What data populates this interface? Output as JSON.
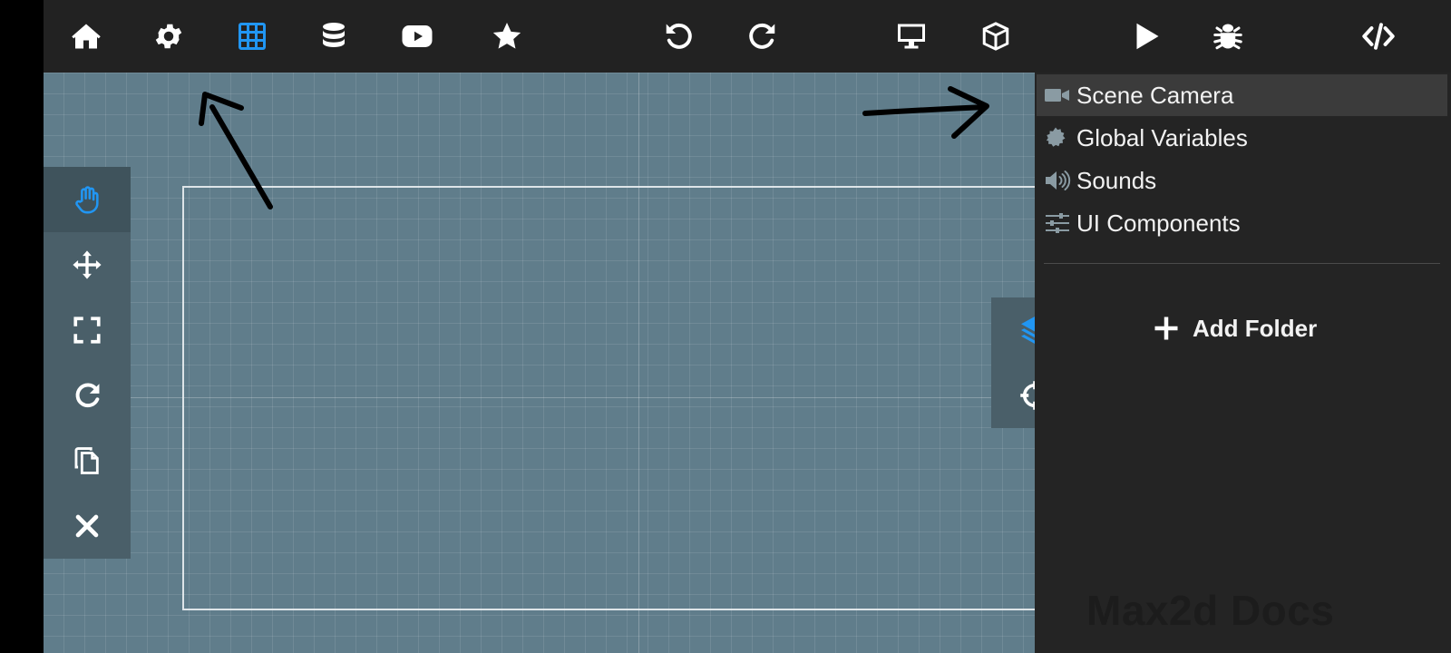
{
  "toolbar": {
    "icons": [
      "home-icon",
      "settings-icon",
      "grid-icon",
      "database-icon",
      "youtube-icon",
      "star-icon",
      "undo-icon",
      "redo-icon",
      "monitor-icon",
      "cube-icon",
      "play-icon",
      "bug-icon",
      "code-icon"
    ],
    "active_icon": "grid-icon"
  },
  "left_tools": {
    "icons": [
      "hand-icon",
      "move-icon",
      "scale-icon",
      "rotate-icon",
      "copy-icon",
      "delete-icon"
    ],
    "active_icon": "hand-icon"
  },
  "right_tools": {
    "icons": [
      "layers-icon",
      "crosshair-icon"
    ]
  },
  "side_panel": {
    "items": [
      {
        "label": "Scene Camera",
        "icon": "video-camera-icon",
        "selected": true
      },
      {
        "label": "Global Variables",
        "icon": "badge-icon",
        "selected": false
      },
      {
        "label": "Sounds",
        "icon": "speaker-icon",
        "selected": false
      },
      {
        "label": "UI Components",
        "icon": "sliders-icon",
        "selected": false
      }
    ],
    "add_folder_label": "Add Folder",
    "watermark": "Max2d Docs"
  },
  "colors": {
    "toolbar_bg": "#222222",
    "canvas_bg": "#607d8b",
    "panel_bg": "#242424",
    "tool_panel_bg": "#4a5f69",
    "accent": "#2196f3",
    "icon": "#ffffff",
    "panel_icon": "#8a9ba3"
  }
}
